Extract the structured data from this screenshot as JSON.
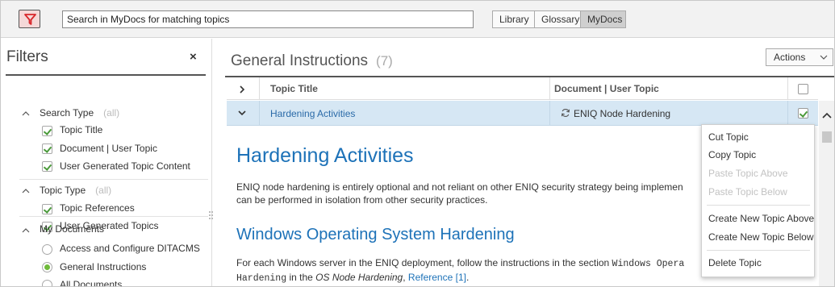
{
  "toolbar": {
    "search_value": "Search in MyDocs for matching topics",
    "tabs": [
      "Library",
      "Glossary",
      "MyDocs"
    ],
    "active_tab": "MyDocs"
  },
  "filters": {
    "title": "Filters",
    "close": "×",
    "search_type": {
      "label": "Search Type",
      "all": "(all)",
      "items": [
        "Topic Title",
        "Document | User Topic",
        "User Generated Topic Content"
      ]
    },
    "topic_type": {
      "label": "Topic Type",
      "all": "(all)",
      "items": [
        "Topic References",
        "User Generated Topics"
      ]
    },
    "my_documents": {
      "label": "My Documents",
      "items": [
        "Access and Configure DITACMS",
        "General Instructions",
        "All Documents"
      ],
      "selected": "General Instructions"
    }
  },
  "main": {
    "title": "General Instructions",
    "count": "(7)",
    "actions_label": "Actions",
    "columns": {
      "title": "Topic Title",
      "document": "Document | User Topic"
    },
    "row": {
      "title": "Hardening Activities",
      "document": "ENIQ Node Hardening",
      "checked": true
    }
  },
  "content": {
    "heading": "Hardening Activities",
    "para1_line1": "ENIQ node hardening is entirely optional and not reliant on other ENIQ security strategy being implemen",
    "para1_line2": "can be performed in isolation from other security practices.",
    "subheading": "Windows Operating System Hardening",
    "para2_pre": "For each Windows server in the ENIQ deployment, follow the instructions in the section ",
    "para2_code1": "Windows Opera",
    "para2_code2": "Hardening",
    "para2_mid": " in the ",
    "para2_em": "OS Node Hardening",
    "para2_sep": ", ",
    "para2_link": "Reference [1]",
    "para2_end": "."
  },
  "context_menu": {
    "items": [
      {
        "label": "Cut Topic",
        "enabled": true
      },
      {
        "label": "Copy Topic",
        "enabled": true
      },
      {
        "label": "Paste Topic Above",
        "enabled": false
      },
      {
        "label": "Paste Topic Below",
        "enabled": false
      },
      {
        "label": "Create New Topic Above",
        "enabled": true
      },
      {
        "label": "Create New Topic Below",
        "enabled": true
      },
      {
        "label": "Delete Topic",
        "enabled": true
      }
    ]
  },
  "colors": {
    "accent": "#1d72b8",
    "row_selected": "#d6e7f4",
    "check": "#4a9a3a",
    "filter_icon": "#d9262b"
  },
  "icons": [
    "filter-icon",
    "close-icon",
    "chevron-up-icon",
    "chevron-right-icon",
    "chevron-down-icon",
    "sync-icon",
    "scroll-up-icon"
  ]
}
